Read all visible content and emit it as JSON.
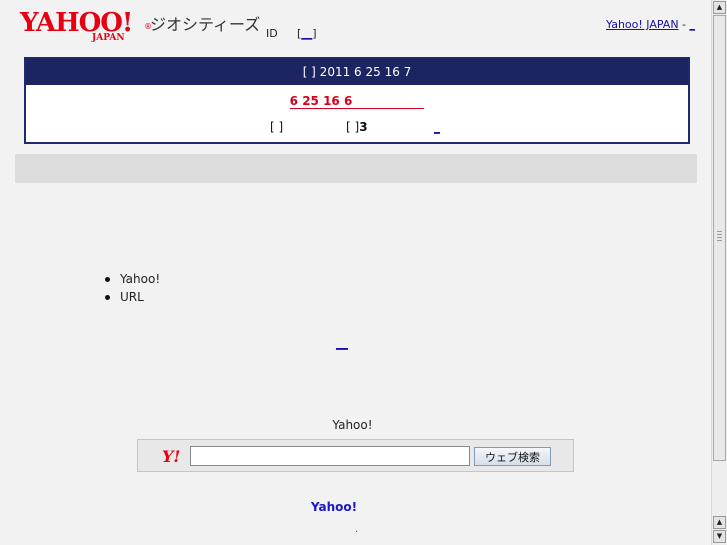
{
  "header": {
    "logo_text": "YAHOO!",
    "logo_sub": "JAPAN",
    "logo_reg": "®",
    "service_name": "ジオシティーズ",
    "id_label": "ID",
    "id_link_open": "[",
    "id_link_text": "__",
    "id_link_close": "]",
    "top_right_link": "Yahoo! JAPAN",
    "top_right_sep": " - ",
    "top_right_link2": "_"
  },
  "notice": {
    "head_text": "[ ] 2011 6 25 16 7",
    "line1_text": "6 25 16 6",
    "line2_a": "[ ]",
    "line2_b_prefix": "[ ]",
    "line2_b_bold": "3",
    "line2_link": "_"
  },
  "list": {
    "items": [
      "Yahoo!",
      "URL"
    ]
  },
  "middle_link": "__",
  "search": {
    "label": "Yahoo!",
    "logo": "Y!",
    "input_value": "",
    "button_label": "ウェブ検索"
  },
  "footer": {
    "yahoo_text": "Yahoo!",
    "dot": "."
  },
  "scrollbar": {
    "up": "▲",
    "down": "▼"
  }
}
